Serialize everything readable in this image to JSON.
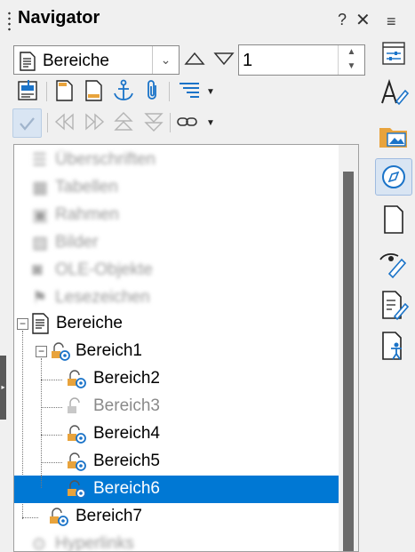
{
  "panel": {
    "title": "Navigator",
    "help_label": "?",
    "close_label": "✕"
  },
  "toolbar": {
    "category_select_value": "Bereiche",
    "spin_value": "1"
  },
  "tree": {
    "items": [
      {
        "label": "Überschriften",
        "state": "blurred"
      },
      {
        "label": "Tabellen",
        "state": "blurred"
      },
      {
        "label": "Rahmen",
        "state": "blurred"
      },
      {
        "label": "Bilder",
        "state": "blurred"
      },
      {
        "label": "OLE-Objekte",
        "state": "blurred"
      },
      {
        "label": "Lesezeichen",
        "state": "blurred"
      },
      {
        "label": "Bereiche",
        "state": "expanded"
      },
      {
        "label": "Bereich1",
        "state": "expanded"
      },
      {
        "label": "Bereich2",
        "state": "normal"
      },
      {
        "label": "Bereich3",
        "state": "hidden"
      },
      {
        "label": "Bereich4",
        "state": "normal"
      },
      {
        "label": "Bereich5",
        "state": "normal"
      },
      {
        "label": "Bereich6",
        "state": "selected"
      },
      {
        "label": "Bereich7",
        "state": "normal"
      },
      {
        "label": "Hyperlinks",
        "state": "blurred"
      }
    ]
  },
  "colors": {
    "selection": "#0078d4",
    "accent_blue": "#1a73c8",
    "lock_orange": "#e8a33c"
  },
  "sidebar_icons": [
    "properties-icon",
    "styles-icon",
    "gallery-icon",
    "navigator-icon",
    "page-icon",
    "style-inspector-icon",
    "manage-changes-icon",
    "accessibility-check-icon"
  ]
}
